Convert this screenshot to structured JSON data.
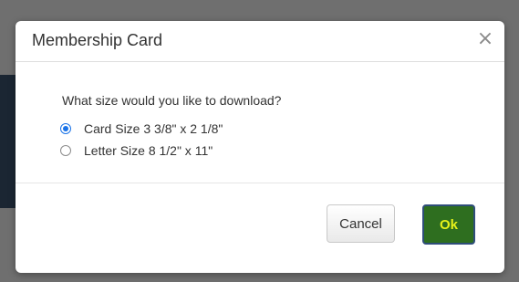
{
  "dialog": {
    "title": "Membership Card",
    "close_glyph": "×"
  },
  "body": {
    "question": "What size would you like to download?",
    "options": [
      {
        "label": "Card Size 3 3/8\" x 2 1/8\"",
        "selected": true
      },
      {
        "label": "Letter Size 8 1/2\" x 11\"",
        "selected": false
      }
    ]
  },
  "footer": {
    "cancel_label": "Cancel",
    "ok_label": "Ok"
  },
  "colors": {
    "ok_background": "#2e6e1f",
    "ok_text": "#e6f21a",
    "radio_accent": "#1a73e8"
  }
}
